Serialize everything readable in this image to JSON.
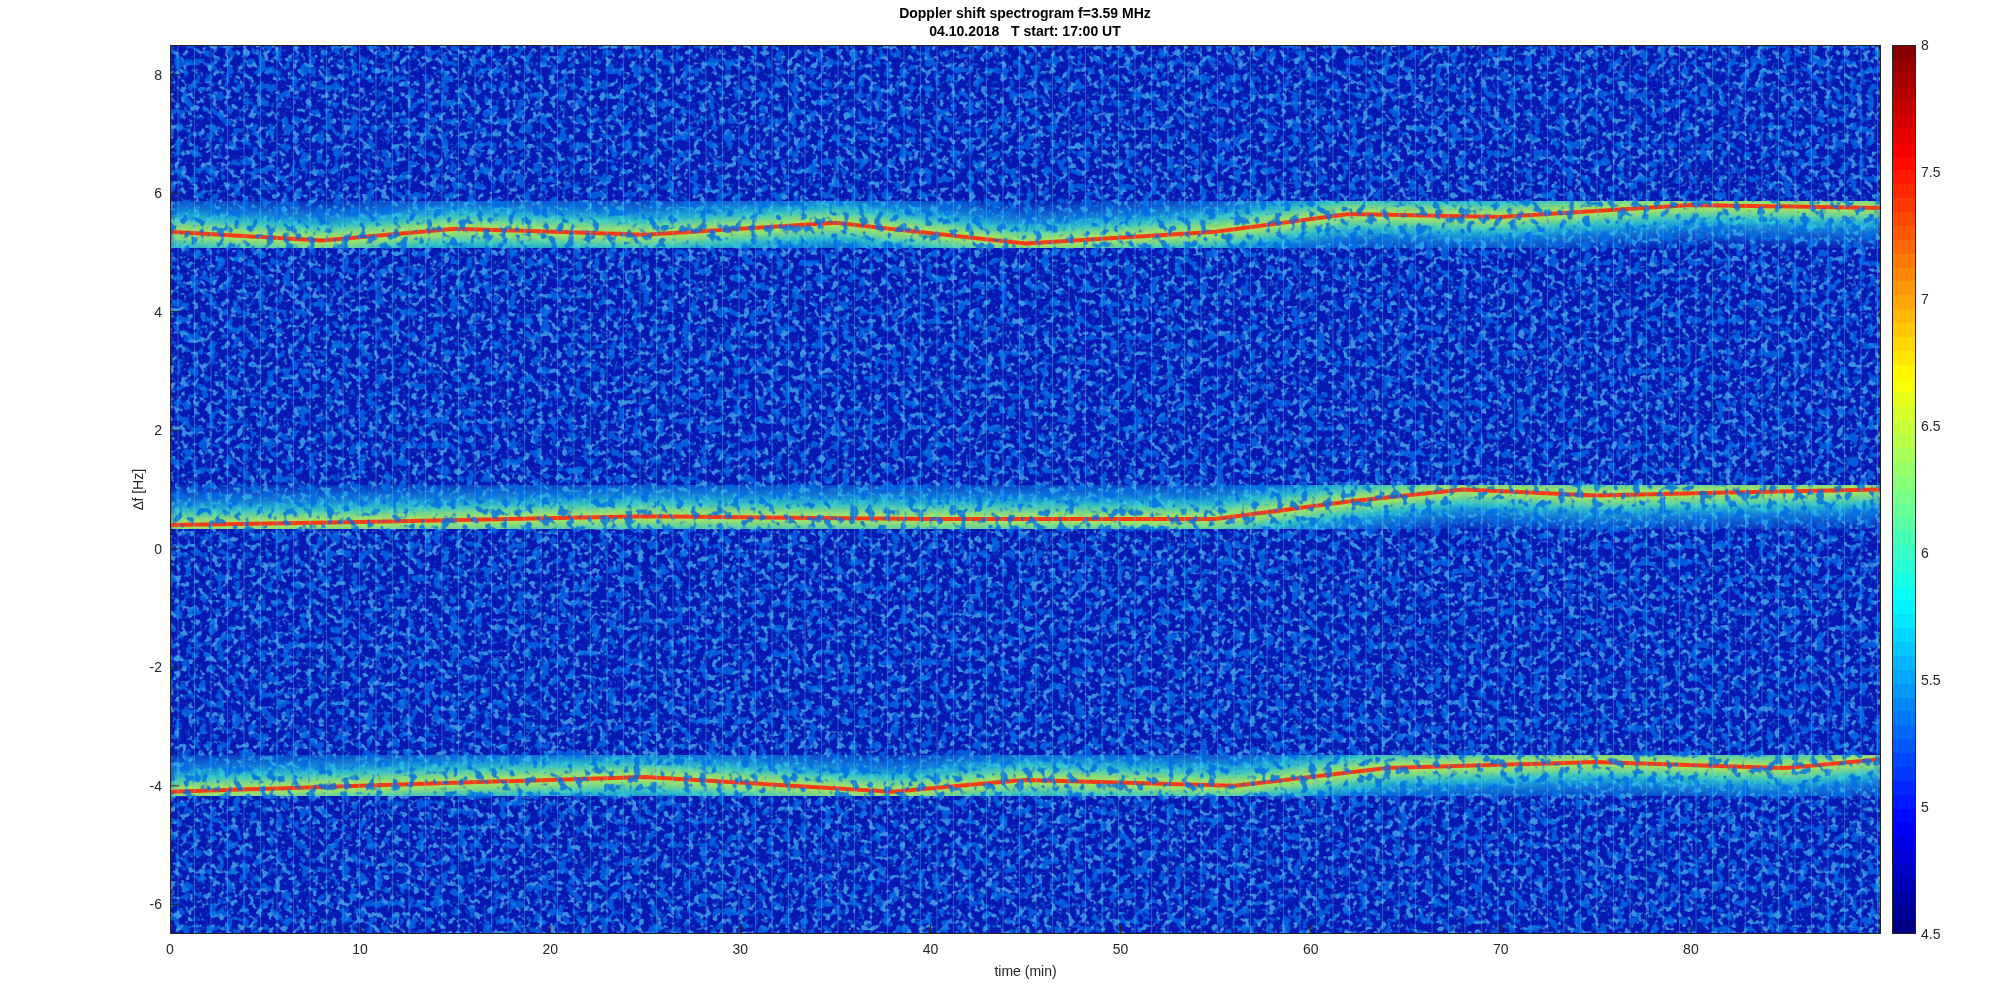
{
  "figure": {
    "title": "Doppler shift spectrogram f=3.59 MHz",
    "subtitle": "04.10.2018   T start: 17:00 UT"
  },
  "axes": {
    "xlabel": "time (min)",
    "ylabel": "∆f [Hz]",
    "xticks": [
      "0",
      "10",
      "20",
      "30",
      "40",
      "50",
      "60",
      "70",
      "80"
    ],
    "yticks": [
      "8",
      "6",
      "4",
      "2",
      "0",
      "-2",
      "-4",
      "-6"
    ]
  },
  "colorbar": {
    "ticks": [
      "8",
      "7.5",
      "7",
      "6.5",
      "6",
      "5.5",
      "5",
      "4.5"
    ]
  }
}
